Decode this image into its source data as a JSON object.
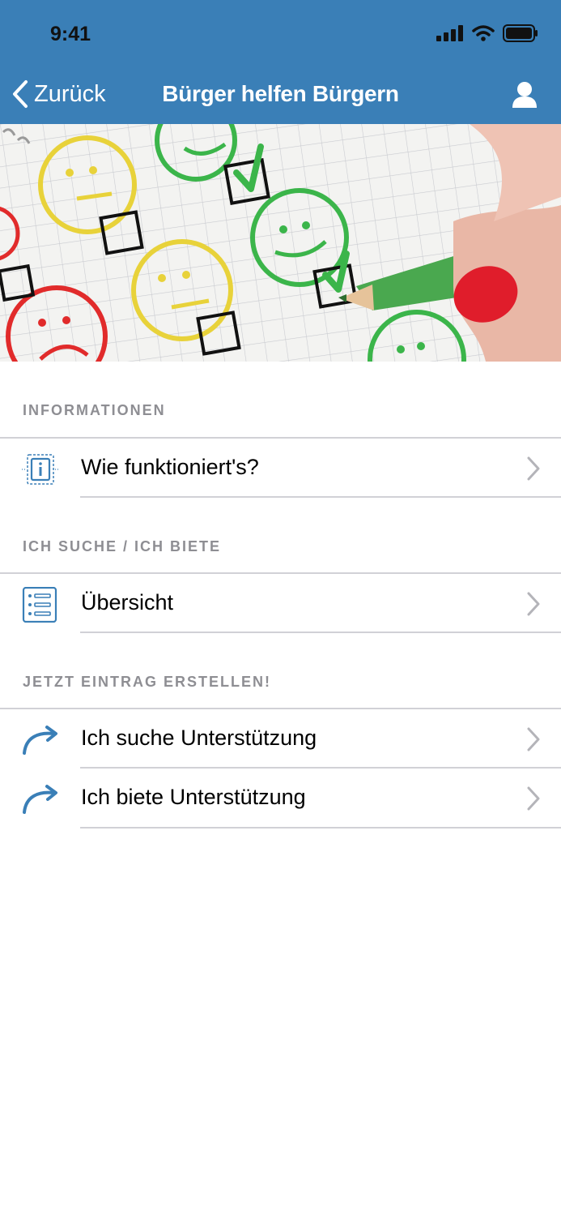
{
  "status": {
    "time": "9:41"
  },
  "nav": {
    "back_label": "Zurück",
    "title": "Bürger helfen Bürgern"
  },
  "sections": [
    {
      "header": "INFORMATIONEN",
      "items": [
        {
          "label": "Wie funktioniert's?",
          "icon": "info-icon"
        }
      ]
    },
    {
      "header": "ICH SUCHE / ICH BIETE",
      "items": [
        {
          "label": "Übersicht",
          "icon": "list-icon"
        }
      ]
    },
    {
      "header": "JETZT EINTRAG ERSTELLEN!",
      "items": [
        {
          "label": "Ich suche Unterstützung",
          "icon": "forward-arrow-icon"
        },
        {
          "label": "Ich biete Unterstützung",
          "icon": "forward-arrow-icon"
        }
      ]
    }
  ],
  "colors": {
    "accent": "#3a7fb7",
    "separator": "#d1d1d6",
    "section_text": "#8e8e93"
  }
}
